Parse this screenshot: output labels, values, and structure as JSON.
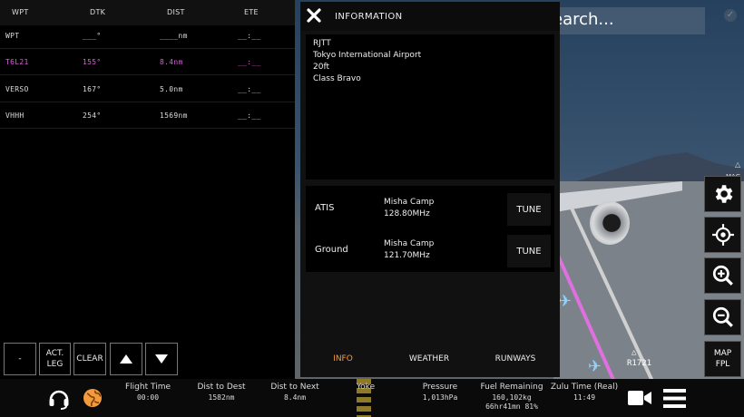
{
  "search": {
    "text": "earch..."
  },
  "map": {
    "mag_label": "MAG",
    "waypoint_label": "R1721",
    "triangle": "△"
  },
  "tools": {
    "map_fpl_line1": "MAP",
    "map_fpl_line2": "FPL"
  },
  "flight_plan": {
    "headers": {
      "wpt": "WPT",
      "dtk": "DTK",
      "dist": "DIST",
      "ete": "ETE"
    },
    "rows": [
      {
        "wpt": "WPT",
        "dtk": "___°",
        "dist": "____nm",
        "ete": "__:__",
        "active": false
      },
      {
        "wpt": "T6L21",
        "dtk": "155°",
        "dist": "8.4nm",
        "ete": "__:__",
        "active": true
      },
      {
        "wpt": "VERSO",
        "dtk": "167°",
        "dist": "5.0nm",
        "ete": "__:__",
        "active": false
      },
      {
        "wpt": "VHHH",
        "dtk": "254°",
        "dist": "1569nm",
        "ete": "__:__",
        "active": false
      }
    ],
    "buttons": {
      "minus": "-",
      "act_leg_1": "ACT.",
      "act_leg_2": "LEG",
      "clear": "CLEAR"
    }
  },
  "information": {
    "title": "INFORMATION",
    "airport": {
      "code": "RJTT",
      "name": "Tokyo International Airport",
      "elevation": "20ft",
      "airspace": "Class Bravo"
    },
    "frequencies": [
      {
        "type": "ATIS",
        "name": "Misha Camp",
        "freq": "128.80MHz",
        "action": "TUNE"
      },
      {
        "type": "Ground",
        "name": "Misha Camp",
        "freq": "121.70MHz",
        "action": "TUNE"
      }
    ],
    "tabs": [
      {
        "label": "INFO",
        "selected": true
      },
      {
        "label": "WEATHER",
        "selected": false
      },
      {
        "label": "RUNWAYS",
        "selected": false
      }
    ]
  },
  "status_bar": {
    "flight_time": {
      "label": "Flight Time",
      "value": "00:00"
    },
    "dist_to_dest": {
      "label": "Dist to Dest",
      "value": "1582nm"
    },
    "dist_to_next": {
      "label": "Dist to Next",
      "value": "8.4nm"
    },
    "yoke": {
      "label": "Yoke",
      "value": ""
    },
    "pressure": {
      "label": "Pressure",
      "value": "1,013hPa"
    },
    "fuel": {
      "label": "Fuel Remaining",
      "value1": "160,102kg",
      "value2": "66hr41mn 81%"
    },
    "zulu": {
      "label": "Zulu Time (Real)",
      "value": "11:49"
    }
  },
  "colors": {
    "active_waypoint": "#e05ce0",
    "selected_tab": "#f39a3c",
    "globe": "#f39a3c"
  }
}
